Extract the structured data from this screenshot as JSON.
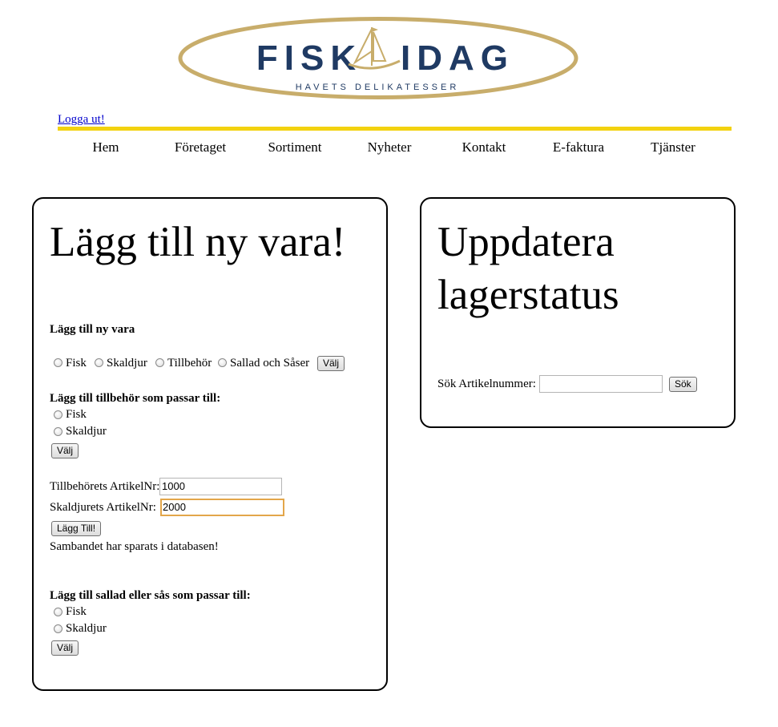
{
  "logo": {
    "wordmark_left": "FISK",
    "wordmark_right": "IDAG",
    "tagline": "HAVETS DELIKATESSER"
  },
  "header": {
    "logout_link": "Logga ut!"
  },
  "nav": [
    "Hem",
    "Företaget",
    "Sortiment",
    "Nyheter",
    "Kontakt",
    "E-faktura",
    "Tjänster"
  ],
  "add_item": {
    "title": "Lägg till ny vara!",
    "section1": {
      "heading": "Lägg till ny vara",
      "options": [
        "Fisk",
        "Skaldjur",
        "Tillbehör",
        "Sallad och Såser"
      ],
      "button": "Välj"
    },
    "section2": {
      "heading": "Lägg till tillbehör som passar till:",
      "options": [
        "Fisk",
        "Skaldjur"
      ],
      "button": "Välj",
      "accessory_label": "Tillbehörets ArtikelNr:",
      "accessory_value": "1000",
      "shellfish_label": "Skaldjurets ArtikelNr:",
      "shellfish_value": "2000",
      "add_button": "Lägg Till!",
      "status": "Sambandet har sparats i databasen!"
    },
    "section3": {
      "heading": "Lägg till sallad eller sås som passar till:",
      "options": [
        "Fisk",
        "Skaldjur"
      ],
      "button": "Välj"
    }
  },
  "stock": {
    "title_line1": "Uppdatera",
    "title_line2": "lagerstatus",
    "search_label": "Sök Artikelnummer:",
    "search_value": "",
    "search_button": "Sök"
  },
  "colors": {
    "gold": "#c8ad6b",
    "navy": "#1f3a63",
    "yellow_bar": "#f3d20f",
    "link": "#0000cc",
    "focus": "#e3a64a"
  }
}
